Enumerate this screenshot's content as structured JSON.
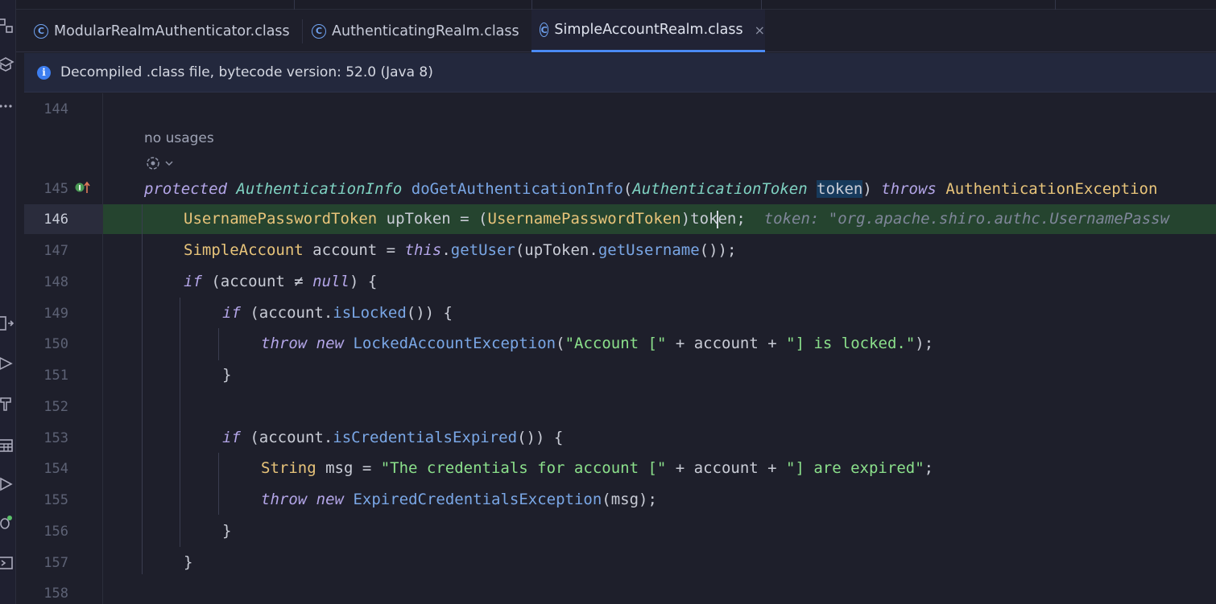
{
  "tabs": [
    {
      "label": "ModularRealmAuthenticator.class",
      "active": false
    },
    {
      "label": "AuthenticatingRealm.class",
      "active": false
    },
    {
      "label": "SimpleAccountRealm.class",
      "active": true
    }
  ],
  "tab_close_glyph": "×",
  "banner": {
    "text": "Decompiled .class file, bytecode version: 52.0 (Java 8)"
  },
  "usage_hint": "no usages",
  "line_numbers": [
    "144",
    "145",
    "146",
    "147",
    "148",
    "149",
    "150",
    "151",
    "152",
    "153",
    "154",
    "155",
    "156",
    "157",
    "158"
  ],
  "current_line": "146",
  "code": {
    "l145": {
      "kw1": "protected",
      "ret": "AuthenticationInfo",
      "fn": "doGetAuthenticationInfo",
      "p1": "(",
      "ptype": "AuthenticationToken",
      "pname": "token",
      "p2": ")",
      "kw2": "throws",
      "exc": "AuthenticationException"
    },
    "l146": {
      "type": "UsernamePasswordToken",
      "rest1": " upToken = (",
      "cast": "UsernamePasswordToken",
      "rest2a": ")tok",
      "rest2b": "en;",
      "inlay": "token: \"org.apache.shiro.authc.UsernamePassw"
    },
    "l147": {
      "type": "SimpleAccount",
      "rest1": " account = ",
      "this": "this",
      "dot1": ".",
      "fn1": "getUser",
      "p1": "(upToken.",
      "fn2": "getUsername",
      "p2": "());"
    },
    "l148": {
      "kw": "if",
      "p1": " (account ≠ ",
      "null": "null",
      "p2": ") {"
    },
    "l149": {
      "kw": "if",
      "p1": " (account.",
      "fn": "isLocked",
      "p2": "()) {"
    },
    "l150": {
      "kw1": "throw",
      "kw2": "new",
      "cls": "LockedAccountException",
      "p1": "(",
      "s1": "\"Account [\"",
      "p2": " + account + ",
      "s2": "\"] is locked.\"",
      "p3": ");"
    },
    "l151": {
      "text": "}"
    },
    "l153": {
      "kw": "if",
      "p1": " (account.",
      "fn": "isCredentialsExpired",
      "p2": "()) {"
    },
    "l154": {
      "type": "String",
      "p1": " msg = ",
      "s1": "\"The credentials for account [\"",
      "p2": " + account + ",
      "s2": "\"] are expired\"",
      "p3": ";"
    },
    "l155": {
      "kw1": "throw",
      "kw2": "new",
      "cls": "ExpiredCredentialsException",
      "p1": "(msg);"
    },
    "l156": {
      "text": "}"
    },
    "l157": {
      "text": "}"
    }
  },
  "colors": {
    "accent": "#4a8af4",
    "background": "#1e1f2b",
    "highlight_line": "#25442f",
    "banner": "#23283d"
  }
}
